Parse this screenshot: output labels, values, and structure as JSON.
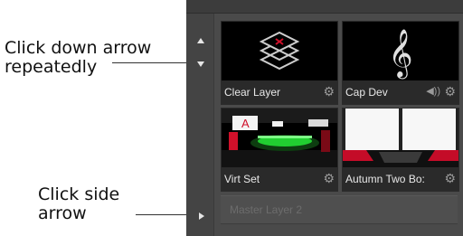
{
  "annotations": {
    "down_arrow_line1": "Click down arrow",
    "down_arrow_line2": "repeatedly",
    "side_arrow_line1": "Click side",
    "side_arrow_line2": "arrow"
  },
  "layers": [
    {
      "label": "Clear Layer",
      "icon": "gear-icon"
    },
    {
      "label": "Cap Dev",
      "icon": "gear-icon",
      "extra_icon": "speaker-icon"
    },
    {
      "label": "Virt Set",
      "icon": "gear-icon"
    },
    {
      "label": "Autumn Two Bo:",
      "icon": "gear-icon"
    }
  ],
  "master": {
    "label": "Master Layer 2"
  },
  "colors": {
    "panel": "#4a4a4a",
    "accent_red": "#d0102a",
    "accent_green": "#28ff3c"
  }
}
